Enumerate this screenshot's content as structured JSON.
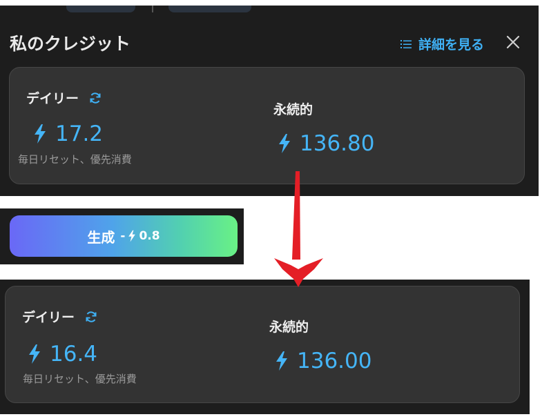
{
  "top_panel": {
    "title": "私のクレジット",
    "details_link": "詳細を見る",
    "daily": {
      "label": "デイリー",
      "value": "17.2",
      "note": "毎日リセット、優先消費"
    },
    "permanent": {
      "label": "永続的",
      "value": "136.80"
    }
  },
  "generate_button": {
    "label": "生成",
    "cost_prefix": "-",
    "cost": "0.8"
  },
  "bottom_panel": {
    "daily": {
      "label": "デイリー",
      "value": "16.4",
      "note": "毎日リセット、優先消費"
    },
    "permanent": {
      "label": "永続的",
      "value": "136.00"
    }
  },
  "colors": {
    "accent_blue": "#3fb1f5",
    "arrow_red": "#e41e26",
    "panel_bg": "#1d1d1d",
    "card_bg": "#333333"
  },
  "icons": [
    "list-icon",
    "close-icon",
    "refresh-icon",
    "lightning-icon",
    "arrow-down-icon"
  ]
}
